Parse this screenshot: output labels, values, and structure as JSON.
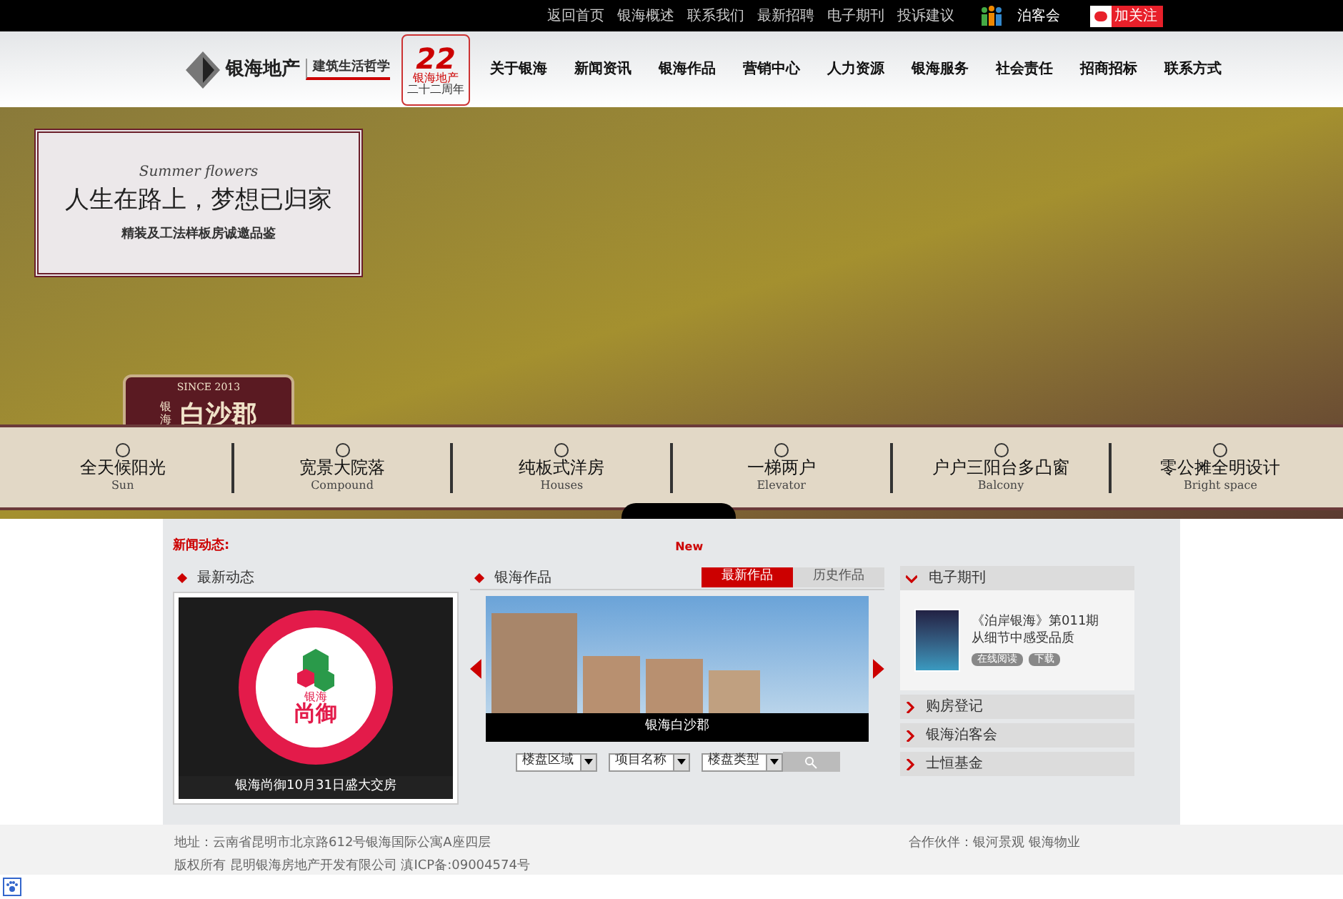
{
  "top_links": [
    "返回首页",
    "银海概述",
    "联系我们",
    "最新招聘",
    "电子期刊",
    "投诉建议"
  ],
  "club_link": "泊客会",
  "follow_button": "加关注",
  "logo": {
    "name": "银海地产",
    "slogan": "建筑生活哲学",
    "anniversary_number": "22",
    "anniversary_name": "银海地产",
    "anniversary_text": "二十二周年"
  },
  "nav": [
    "关于银海",
    "新闻资讯",
    "银海作品",
    "营销中心",
    "人力资源",
    "银海服务",
    "社会责任",
    "招商招标",
    "联系方式"
  ],
  "banner": {
    "script_title": "Summer flowers",
    "headline": "人生在路上，梦想已归家",
    "subtitle": "精装及工法样板房诚邀品鉴",
    "badge_since": "SINCE 2013",
    "badge_brand": "银海",
    "badge_name": "白沙郡",
    "features": [
      {
        "name": "全天候阳光",
        "english": "Sun"
      },
      {
        "name": "宽景大院落",
        "english": "Compound"
      },
      {
        "name": "纯板式洋房",
        "english": "Houses"
      },
      {
        "name": "一梯两户",
        "english": "Elevator"
      },
      {
        "name": "户户三阳台多凸窗",
        "english": "Balcony"
      },
      {
        "name": "零公摊全明设计",
        "english": "Bright space"
      }
    ]
  },
  "ticker": {
    "label": "新闻动态:",
    "badge": "New"
  },
  "latest_news": {
    "title": "最新动态",
    "poster_brand": "银海",
    "poster_name": "尚御",
    "caption": "银海尚御10月31日盛大交房"
  },
  "works": {
    "title": "银海作品",
    "tabs": [
      {
        "label": "最新作品",
        "selected": true
      },
      {
        "label": "历史作品",
        "selected": false
      }
    ],
    "caption": "银海白沙郡",
    "filters": [
      "楼盘区域",
      "项目名称",
      "楼盘类型"
    ]
  },
  "sidebar": {
    "magazine_title": "电子期刊",
    "magazine_line1": "《泊岸银海》第011期",
    "magazine_line2": "从细节中感受品质",
    "read_button": "在线阅读",
    "download_button": "下载",
    "links": [
      "购房登记",
      "银海泊客会",
      "士恒基金"
    ]
  },
  "footer": {
    "address": "地址：云南省昆明市北京路612号银海国际公寓A座四层",
    "copyright": "版权所有 昆明银海房地产开发有限公司 滇ICP备:09004574号",
    "partners": "合作伙伴：银河景观 银海物业"
  }
}
